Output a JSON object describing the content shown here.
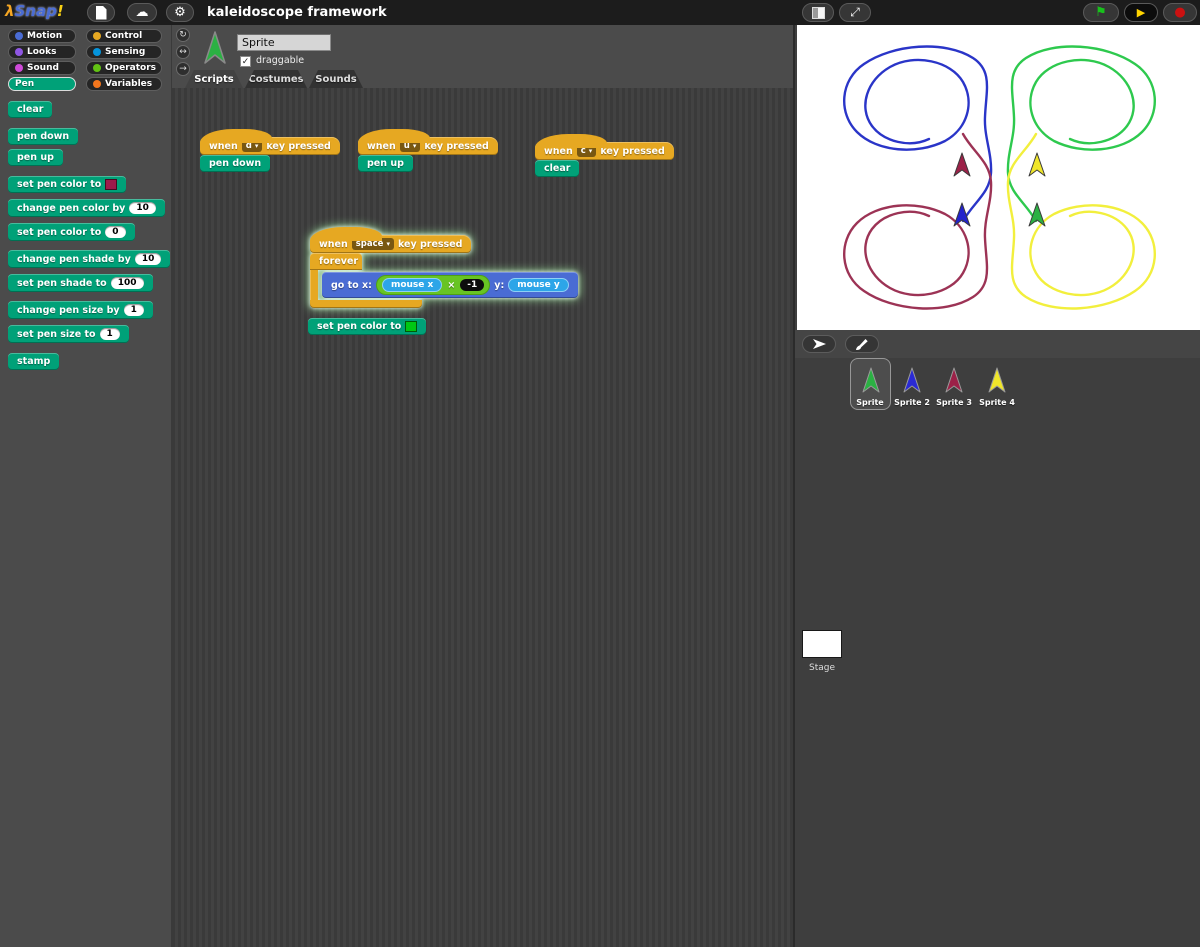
{
  "titlebar": {
    "logo_lambda": "λ",
    "logo_name": "Snap",
    "logo_bang": "!",
    "title": "kaleidoscope framework"
  },
  "icons": {
    "dropdown": "▾",
    "cloud": "☁",
    "settings": "⚙",
    "flag": "⚑",
    "play": "▶",
    "stop": "●",
    "grow": "⤢",
    "check": "✓",
    "rotate": "↻",
    "flip": "↔",
    "point_right": "→"
  },
  "palette": {
    "categories": [
      {
        "label": "Motion",
        "color": "#4a6cd4",
        "selected": false
      },
      {
        "label": "Control",
        "color": "#e6a822",
        "selected": false
      },
      {
        "label": "Looks",
        "color": "#8f56e3",
        "selected": false
      },
      {
        "label": "Sensing",
        "color": "#0494dc",
        "selected": false
      },
      {
        "label": "Sound",
        "color": "#cf4ad9",
        "selected": false
      },
      {
        "label": "Operators",
        "color": "#62c213",
        "selected": false
      },
      {
        "label": "Pen",
        "color": "#00a178",
        "selected": true
      },
      {
        "label": "Variables",
        "color": "#f3761d",
        "selected": false
      }
    ],
    "blocks": {
      "clear": "clear",
      "pen_down": "pen down",
      "pen_up": "pen up",
      "set_pen_color_swatch": {
        "label": "set pen color to",
        "swatch": "#9c1a4b"
      },
      "change_pen_color": {
        "label": "change pen color by",
        "value": "10"
      },
      "set_pen_color_num": {
        "label": "set pen color to",
        "value": "0"
      },
      "change_pen_shade": {
        "label": "change pen shade by",
        "value": "10"
      },
      "set_pen_shade": {
        "label": "set pen shade to",
        "value": "100"
      },
      "change_pen_size": {
        "label": "change pen size by",
        "value": "1"
      },
      "set_pen_size": {
        "label": "set pen size to",
        "value": "1"
      },
      "stamp": "stamp"
    }
  },
  "sprite_header": {
    "name": "Sprite",
    "draggable_label": "draggable",
    "draggable_checked": true,
    "tabs": [
      "Scripts",
      "Costumes",
      "Sounds"
    ]
  },
  "scripts": {
    "s1": {
      "when": "when",
      "key": "d",
      "rest": "key pressed",
      "body": "pen down"
    },
    "s2": {
      "when": "when",
      "key": "u",
      "rest": "key pressed",
      "body": "pen up"
    },
    "s3": {
      "when": "when",
      "key": "c",
      "rest": "key pressed",
      "body": "clear"
    },
    "s4": {
      "when": "when",
      "key": "space",
      "rest": "key pressed",
      "forever": "forever",
      "goto": "go to x:",
      "mouse_x": "mouse x",
      "times": "×",
      "neg": "-1",
      "y": "y:",
      "mouse_y": "mouse y",
      "running_glow": true
    },
    "s5": {
      "label": "set pen color to",
      "swatch": "#00c814"
    }
  },
  "stage": {
    "background": "#ffffff",
    "trails": {
      "top_left": "#2a35c8",
      "top_right": "#2ec94e",
      "bottom_left": "#9c3355",
      "bottom_right": "#f2ef3d"
    },
    "arrows": {
      "top_left": "#9c2148",
      "top_right": "#f0e62a",
      "bottom_left": "#2222cc",
      "bottom_right": "#2bb143"
    }
  },
  "corral": {
    "sprites": [
      {
        "label": "Sprite",
        "color": "#2bb143",
        "selected": true
      },
      {
        "label": "Sprite 2",
        "color": "#2a2ad4",
        "selected": false
      },
      {
        "label": "Sprite 3",
        "color": "#9c2148",
        "selected": false
      },
      {
        "label": "Sprite 4",
        "color": "#f0e62a",
        "selected": false
      }
    ],
    "stage_label": "Stage"
  }
}
